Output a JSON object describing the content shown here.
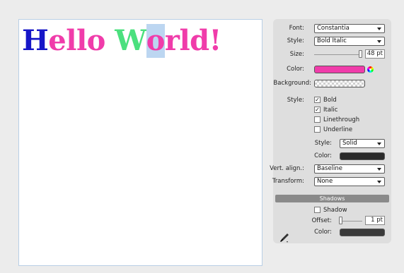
{
  "document": {
    "chars": [
      {
        "t": "H",
        "color": "#1616c8"
      },
      {
        "t": "e",
        "color": "#f03caa"
      },
      {
        "t": "l",
        "color": "#f03caa"
      },
      {
        "t": "l",
        "color": "#f03caa"
      },
      {
        "t": "o",
        "color": "#f03caa"
      },
      {
        "t": " ",
        "color": "#f03caa"
      },
      {
        "t": "W",
        "color": "#4be07e"
      },
      {
        "t": "o",
        "color": "#f03caa",
        "selected": true
      },
      {
        "t": "r",
        "color": "#f03caa"
      },
      {
        "t": "l",
        "color": "#f03caa"
      },
      {
        "t": "d",
        "color": "#f03caa"
      },
      {
        "t": "!",
        "color": "#f03caa"
      }
    ]
  },
  "panel": {
    "font_label": "Font:",
    "font_value": "Constantia",
    "style_label": "Style:",
    "style_value": "Bold Italic",
    "size_label": "Size:",
    "size_value": "48 pt",
    "color_label": "Color:",
    "color_hex": "#f03caa",
    "background_label": "Background:",
    "style2_label": "Style:",
    "bold_label": "Bold",
    "bold_checked": "✓",
    "italic_label": "Italic",
    "italic_checked": "✓",
    "linethrough_label": "Linethrough",
    "underline_label": "Underline",
    "line_style_label": "Style:",
    "line_style_value": "Solid",
    "line_color_label": "Color:",
    "line_color_hex": "#2a2a2a",
    "vert_align_label": "Vert. align.:",
    "vert_align_value": "Baseline",
    "transform_label": "Transform:",
    "transform_value": "None",
    "shadows_header": "Shadows",
    "shadow_label": "Shadow",
    "offset_label": "Offset:",
    "offset_value": "1 pt",
    "shadow_color_label": "Color:",
    "shadow_color_hex": "#3a3a3a",
    "brush_icon": "paint-brush-icon"
  }
}
